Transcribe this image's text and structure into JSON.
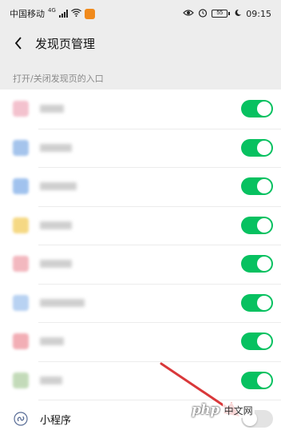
{
  "status_bar": {
    "carrier": "中国移动",
    "network": "4G",
    "battery": "55",
    "time": "09:15"
  },
  "header": {
    "title": "发现页管理",
    "back_icon": "chevron-left-icon"
  },
  "section_hint": "打开/关闭发现页的入口",
  "rows": [
    {
      "icon_color": "#f1b3c2",
      "toggle": true,
      "label_width": 30
    },
    {
      "icon_color": "#8fb6e8",
      "toggle": true,
      "label_width": 40
    },
    {
      "icon_color": "#8ab4ea",
      "toggle": true,
      "label_width": 46
    },
    {
      "icon_color": "#f3cf66",
      "toggle": true,
      "label_width": 40
    },
    {
      "icon_color": "#f0a7b0",
      "toggle": true,
      "label_width": 40
    },
    {
      "icon_color": "#a7c7ef",
      "toggle": true,
      "label_width": 56
    },
    {
      "icon_color": "#ef9aa3",
      "toggle": true,
      "label_width": 30
    },
    {
      "icon_color": "#b5d2a8",
      "toggle": true,
      "label_width": 28
    }
  ],
  "mini_program": {
    "label": "小程序",
    "icon": "mini-program-icon",
    "toggle": false
  },
  "watermark": {
    "logo": "php",
    "text": "中文网"
  },
  "colors": {
    "toggle_on": "#07c160",
    "toggle_off": "#e3e3e3",
    "arrow": "#d9383a"
  }
}
